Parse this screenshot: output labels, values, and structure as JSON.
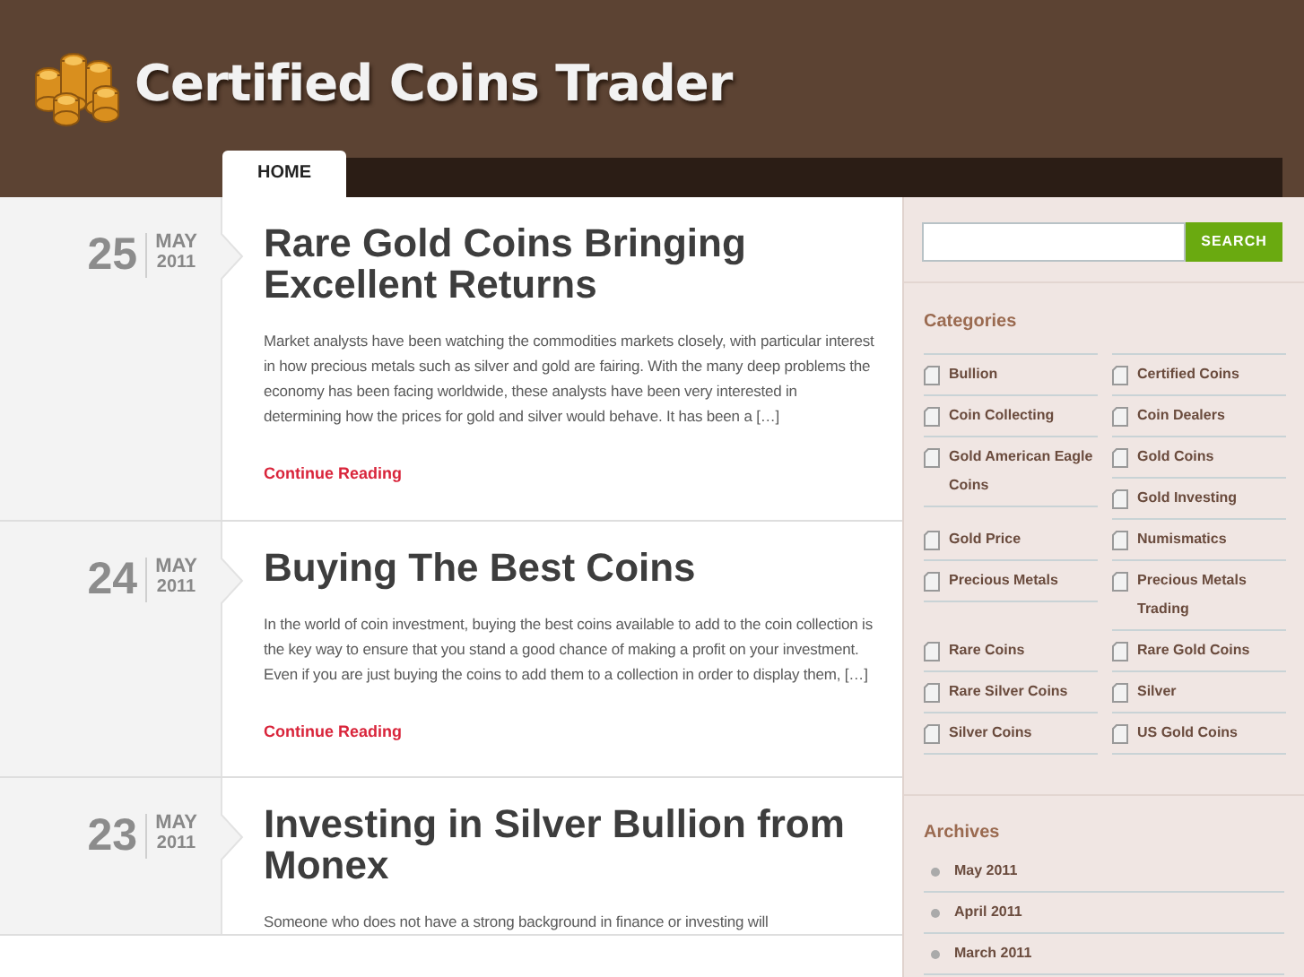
{
  "site": {
    "title": "Certified Coins Trader"
  },
  "nav": [
    {
      "label": "HOME",
      "selected": true
    }
  ],
  "posts": [
    {
      "day": "25",
      "month": "MAY",
      "year": "2011",
      "title": "Rare Gold Coins Bringing Excellent Returns",
      "excerpt": "Market analysts have been watching the commodities markets closely, with particular interest in how precious metals such as silver and gold are fairing. With the many deep problems the economy has been facing worldwide, these analysts have been very interested in determining how the prices for gold and silver would behave. It has been a […]",
      "more": "Continue Reading"
    },
    {
      "day": "24",
      "month": "MAY",
      "year": "2011",
      "title": "Buying The Best Coins",
      "excerpt": "In the world of coin investment, buying the best coins available to add to the coin collection is the key way to ensure that you stand a good chance of making a profit on your investment. Even if you are just buying the coins to add them to a collection in order to display them, […]",
      "more": "Continue Reading"
    },
    {
      "day": "23",
      "month": "MAY",
      "year": "2011",
      "title": "Investing in Silver Bullion from Monex",
      "excerpt": "Someone who does not have a strong background in finance or investing will"
    }
  ],
  "search": {
    "button": "SEARCH"
  },
  "categories": {
    "heading": "Categories",
    "items": [
      "Bullion",
      "Certified Coins",
      "Coin Collecting",
      "Coin Dealers",
      "Gold American Eagle Coins",
      "Gold Coins",
      "Gold Investing",
      "Gold Price",
      "Numismatics",
      "Precious Metals",
      "Precious Metals Trading",
      "Rare Coins",
      "Rare Gold Coins",
      "Rare Silver Coins",
      "Silver",
      "Silver Coins",
      "US Gold Coins"
    ]
  },
  "archives": {
    "heading": "Archives",
    "items": [
      "May 2011",
      "April 2011",
      "March 2011"
    ]
  }
}
